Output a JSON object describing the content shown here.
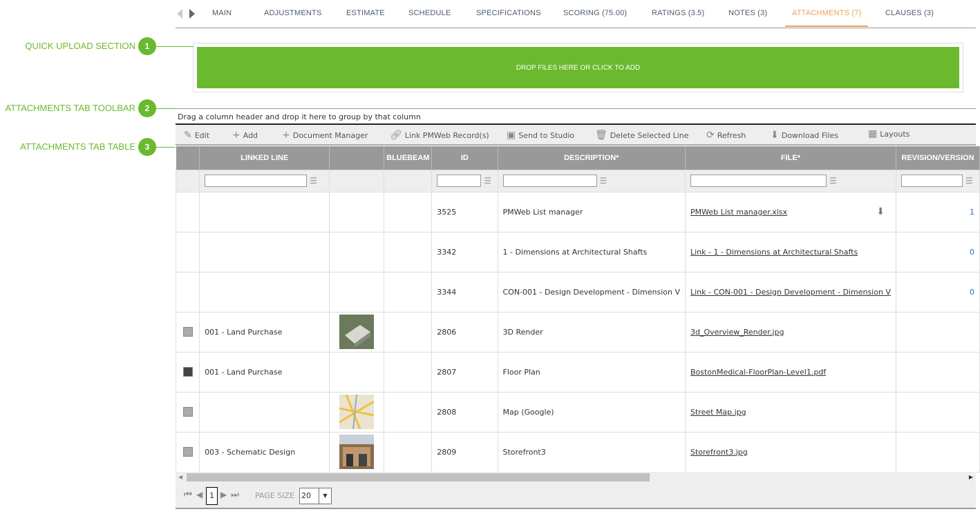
{
  "tabs": [
    "MAIN",
    "ADJUSTMENTS",
    "ESTIMATE",
    "SCHEDULE",
    "SPECIFICATIONS",
    "SCORING (75.00)",
    "RATINGS (3.5)",
    "NOTES (3)",
    "ATTACHMENTS (7)",
    "CLAUSES (3)"
  ],
  "active_tab": "ATTACHMENTS (7)",
  "callouts": [
    {
      "label": "QUICK UPLOAD SECTION",
      "num": "1"
    },
    {
      "label": "ATTACHMENTS TAB TOOLBAR",
      "num": "2"
    },
    {
      "label": "ATTACHMENTS TAB TABLE",
      "num": "3"
    }
  ],
  "upload_label": "DROP FILES HERE OR CLICK TO ADD",
  "group_hint": "Drag a column header and drop it here to group by that column",
  "toolbar": [
    {
      "label": "Edit",
      "icon": "pencil-icon"
    },
    {
      "label": "Add",
      "icon": "plus-icon"
    },
    {
      "label": "Document Manager",
      "icon": "plus-icon"
    },
    {
      "label": "Link PMWeb Record(s)",
      "icon": "link-icon"
    },
    {
      "label": "Send to Studio",
      "icon": "studio-icon"
    },
    {
      "label": "Delete Selected Line",
      "icon": "trash-icon"
    },
    {
      "label": "Refresh",
      "icon": "refresh-icon"
    },
    {
      "label": "Download Files",
      "icon": "download-icon"
    },
    {
      "label": "Layouts",
      "icon": "grid-icon"
    }
  ],
  "columns": [
    "",
    "LINKED LINE",
    "",
    "BLUEBEAM",
    "ID",
    "DESCRIPTION*",
    "FILE*",
    "REVISION/VERSION"
  ],
  "rows": [
    {
      "linked": "",
      "id": "3525",
      "desc": "PMWeb List manager",
      "file": "PMWeb List manager.xlsx",
      "rev": "1",
      "thumb": "",
      "chk": "",
      "dl": true
    },
    {
      "linked": "",
      "id": "3342",
      "desc": "1 - Dimensions at Architectural Shafts",
      "file": "Link - 1 - Dimensions at Architectural Shafts",
      "rev": "0",
      "thumb": "",
      "chk": ""
    },
    {
      "linked": "",
      "id": "3344",
      "desc": "CON-001 - Design Development - Dimension V",
      "file": "Link - CON-001 - Design Development - Dimension V",
      "rev": "0",
      "thumb": "",
      "chk": ""
    },
    {
      "linked": "001 - Land Purchase",
      "id": "2806",
      "desc": "3D Render",
      "file": "3d_Overview_Render.jpg",
      "rev": "",
      "thumb": "render",
      "chk": "light"
    },
    {
      "linked": "001 - Land Purchase",
      "id": "2807",
      "desc": "Floor Plan",
      "file": "BostonMedical-FloorPlan-Level1.pdf",
      "rev": "",
      "thumb": "",
      "chk": "dark"
    },
    {
      "linked": "",
      "id": "2808",
      "desc": "Map (Google)",
      "file": "Street Map.jpg",
      "rev": "",
      "thumb": "map",
      "chk": "light"
    },
    {
      "linked": "003 - Schematic Design",
      "id": "2809",
      "desc": "Storefront3",
      "file": "Storefront3.jpg",
      "rev": "",
      "thumb": "store",
      "chk": "light"
    }
  ],
  "pager": {
    "page": "1",
    "page_size_label": "PAGE SIZE",
    "page_size": "20"
  }
}
